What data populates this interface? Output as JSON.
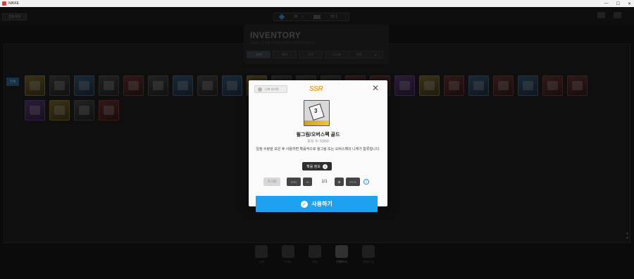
{
  "window": {
    "title": "NIKKE",
    "controls": [
      "—",
      "☐",
      "✕"
    ]
  },
  "topbar": {
    "outpost_label": "전초기지",
    "gems_value": "20",
    "gems_plus": "+",
    "credits_value": "57.1"
  },
  "inventory": {
    "title": "INVENTORY",
    "subtitle": "니케 무기, 장비 및 소모품을 관리하는 인벤토리 화면입니다",
    "tabs": [
      {
        "label": "소비"
      },
      {
        "label": "재화"
      },
      {
        "label": "장비"
      },
      {
        "label": "소모품"
      }
    ],
    "sort_label": "정렬",
    "sort_icon": "chevron-down-icon",
    "filter_all": "전체"
  },
  "bottom_nav": [
    {
      "label": "니케",
      "icon": "nikke-icon"
    },
    {
      "label": "스쿼드",
      "icon": "squad-icon"
    },
    {
      "label": "장비",
      "icon": "gear-icon"
    },
    {
      "label": "인벤토리",
      "icon": "inventory-icon",
      "active": true
    },
    {
      "label": "대원모집",
      "icon": "recruit-icon"
    }
  ],
  "modal": {
    "chip_label": "니케 유저명",
    "rarity": "SSR",
    "item_name": "윌그림/오버스펙 골드",
    "owned": "보유 수: 53/50",
    "description": "일정 수량을 모은 후 사용하면 확률적으로 윌그림 또는 오버스펙의 니케가 합류합니다.",
    "probability_label": "확률 정보",
    "reset_label": "초기화",
    "min_label": "MIN",
    "max_label": "MAX",
    "count": "1/1",
    "use_label": "사용하기",
    "colors": {
      "accent": "#1ea1ef",
      "rarity": "#f0a52c"
    }
  }
}
